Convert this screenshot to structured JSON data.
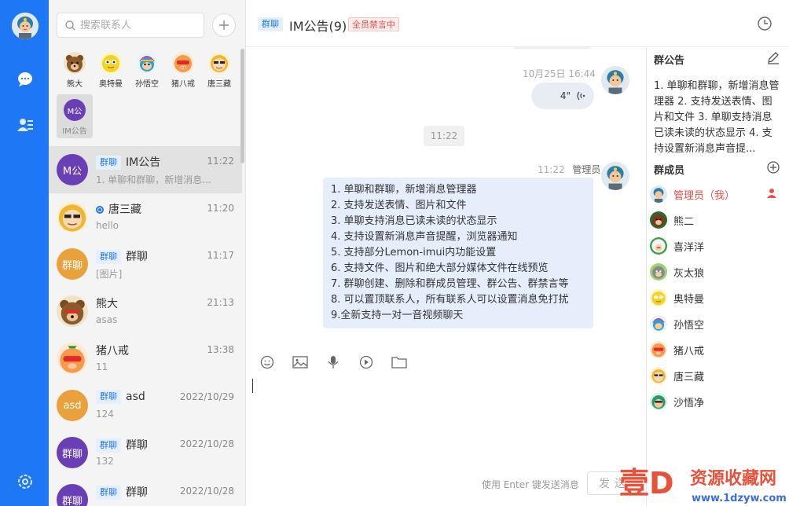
{
  "app": {
    "search_placeholder": "搜索联系人"
  },
  "quick_contacts": [
    {
      "name": "熊大",
      "avatar": "bear-avatar"
    },
    {
      "name": "奥特曼",
      "avatar": "ultraman-avatar"
    },
    {
      "name": "孙悟空",
      "avatar": "monkey-avatar"
    },
    {
      "name": "猪八戒",
      "avatar": "pig-avatar"
    },
    {
      "name": "唐三藏",
      "avatar": "monk-avatar"
    },
    {
      "name": "IM公告",
      "avatar_text": "M公"
    }
  ],
  "conversations": [
    {
      "tag": "群聊",
      "name": "IM公告",
      "time": "11:22",
      "preview": "1. 单聊和群聊，新增消息...",
      "avatar_text": "M公",
      "avatar_color": "#6a3fb5"
    },
    {
      "name": "唐三藏",
      "time": "11:20",
      "preview": "hello",
      "avatar": "monk-avatar"
    },
    {
      "tag": "群聊",
      "name": "群聊",
      "time": "11:17",
      "preview": "[图片]",
      "avatar_text": "群聊",
      "avatar_color": "#e9a23b"
    },
    {
      "name": "熊大",
      "time": "21:13",
      "preview": "asas",
      "avatar": "bear-avatar"
    },
    {
      "name": "猪八戒",
      "time": "13:38",
      "preview": "11",
      "avatar": "pig-avatar"
    },
    {
      "tag": "群聊",
      "name": "asd",
      "time": "2022/10/29",
      "preview": "124",
      "avatar_text": "asd",
      "avatar_color": "#e9a23b"
    },
    {
      "tag": "群聊",
      "name": "群聊",
      "time": "2022/10/28",
      "preview": "132",
      "avatar_text": "群聊",
      "avatar_color": "#6a3fb5"
    },
    {
      "tag": "群聊",
      "name": "群聊",
      "time": "2022/10/28",
      "preview": "",
      "avatar_text": "群聊",
      "avatar_color": "#6a3fb5"
    }
  ],
  "chat": {
    "tag": "群聊",
    "title": "IM公告(9)",
    "mute_badge": "全员禁言中",
    "voice_timestamp": "10月25日 16:44",
    "voice_duration": "4\"",
    "time_divider": "11:22",
    "msg_time": "11:22",
    "msg_sender": "管理员",
    "message_lines": [
      "1. 单聊和群聊，新增消息管理器",
      "2. 支持发送表情、图片和文件",
      "3. 单聊支持消息已读未读的状态显示",
      "4. 支持设置新消息声音提醒，浏览器通知",
      "5. 支持部分Lemon-imui内功能设置",
      "6. 支持文件、图片和绝大部分媒体文件在线预览",
      "7. 群聊创建、删除和群成员管理、群公告、群禁言等",
      "8. 可以置顶联系人，所有联系人可以设置消息免打扰",
      "9.全新支持一对一音视频聊天"
    ],
    "send_hint": "使用 Enter 键发送消息",
    "send_label": "发送"
  },
  "side": {
    "notice_title": "群公告",
    "notice_text": "1. 单聊和群聊，新增消息管理器 2. 支持发送表情、图片和文件 3. 单聊支持消息已读未读的状态显示 4. 支持设置新消息声音提...",
    "members_title": "群成员",
    "members": [
      {
        "name": "管理员（我）",
        "avatar": "admin-avatar",
        "admin": true
      },
      {
        "name": "熊二",
        "avatar": "bear2-avatar"
      },
      {
        "name": "喜洋洋",
        "avatar": "sheep-avatar"
      },
      {
        "name": "灰太狼",
        "avatar": "wolf-avatar"
      },
      {
        "name": "奥特曼",
        "avatar": "ultraman-avatar"
      },
      {
        "name": "孙悟空",
        "avatar": "monkey-avatar"
      },
      {
        "name": "猪八戒",
        "avatar": "pig-avatar"
      },
      {
        "name": "唐三藏",
        "avatar": "monk-avatar"
      },
      {
        "name": "沙悟净",
        "avatar": "sha-avatar"
      }
    ]
  },
  "watermark": {
    "mark": "壹D",
    "name": "资源收藏网",
    "url": "www.1dzyw.com"
  },
  "colors": {
    "accent": "#1e78f6",
    "danger": "#e8504a",
    "bubble": "#e6eefc"
  }
}
